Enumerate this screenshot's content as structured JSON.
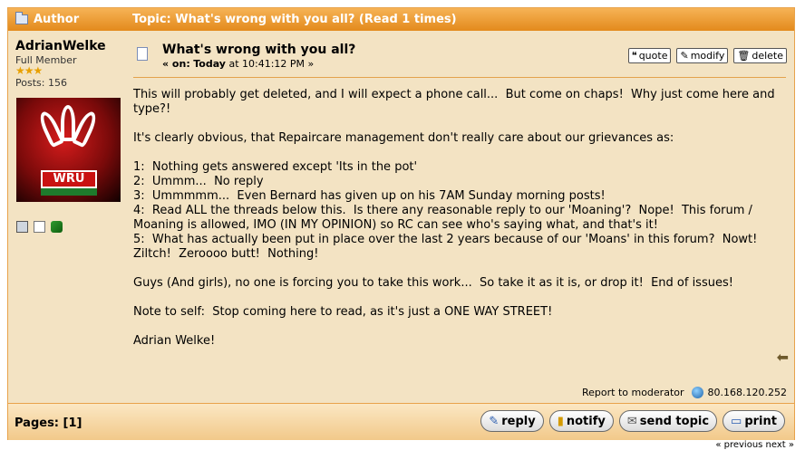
{
  "header": {
    "author_label": "Author",
    "topic_label": "Topic: What's wrong with you all?  (Read 1 times)"
  },
  "author": {
    "name": "AdrianWelke",
    "group": "Full Member",
    "stars": "★★★",
    "posts": "Posts: 156",
    "avatar_text": "WRU"
  },
  "post": {
    "subject": "What's wrong with you all?",
    "date_prefix": "« on:",
    "date_day": "Today",
    "date_time": "at 10:41:12 PM »",
    "actions": {
      "quote": "quote",
      "modify": "modify",
      "delete": "delete"
    },
    "body": [
      "This will probably get deleted, and I will expect a phone call...  But come on chaps!  Why just come here and type?!",
      "",
      "It's clearly obvious, that Repaircare management don't really care about our grievances as:",
      "",
      "1:  Nothing gets answered except 'Its in the pot'",
      "2:  Ummm...  No reply",
      "3:  Ummmmm...  Even Bernard has given up on his 7AM Sunday morning posts!",
      "4:  Read ALL the threads below this.  Is there any reasonable reply to our 'Moaning'?  Nope!  This forum / Moaning is allowed, IMO (IN MY OPINION) so RC can see who's saying what, and that's it!",
      "5:  What has actually been put in place over the last 2 years because of our 'Moans' in this forum?  Nowt!  Ziltch!  Zeroooo butt!  Nothing!",
      "",
      "Guys (And girls), no one is forcing you to take this work...  So take it as it is, or drop it!  End of issues!",
      "",
      "Note to self:  Stop coming here to read, as it's just a ONE WAY STREET!",
      "",
      "Adrian Welke!"
    ],
    "report_label": "Report to moderator",
    "ip": "80.168.120.252"
  },
  "footer": {
    "pages": "Pages: [1]",
    "buttons": {
      "reply": "reply",
      "notify": "notify",
      "send": "send topic",
      "print": "print"
    }
  },
  "nav": "« previous next »"
}
